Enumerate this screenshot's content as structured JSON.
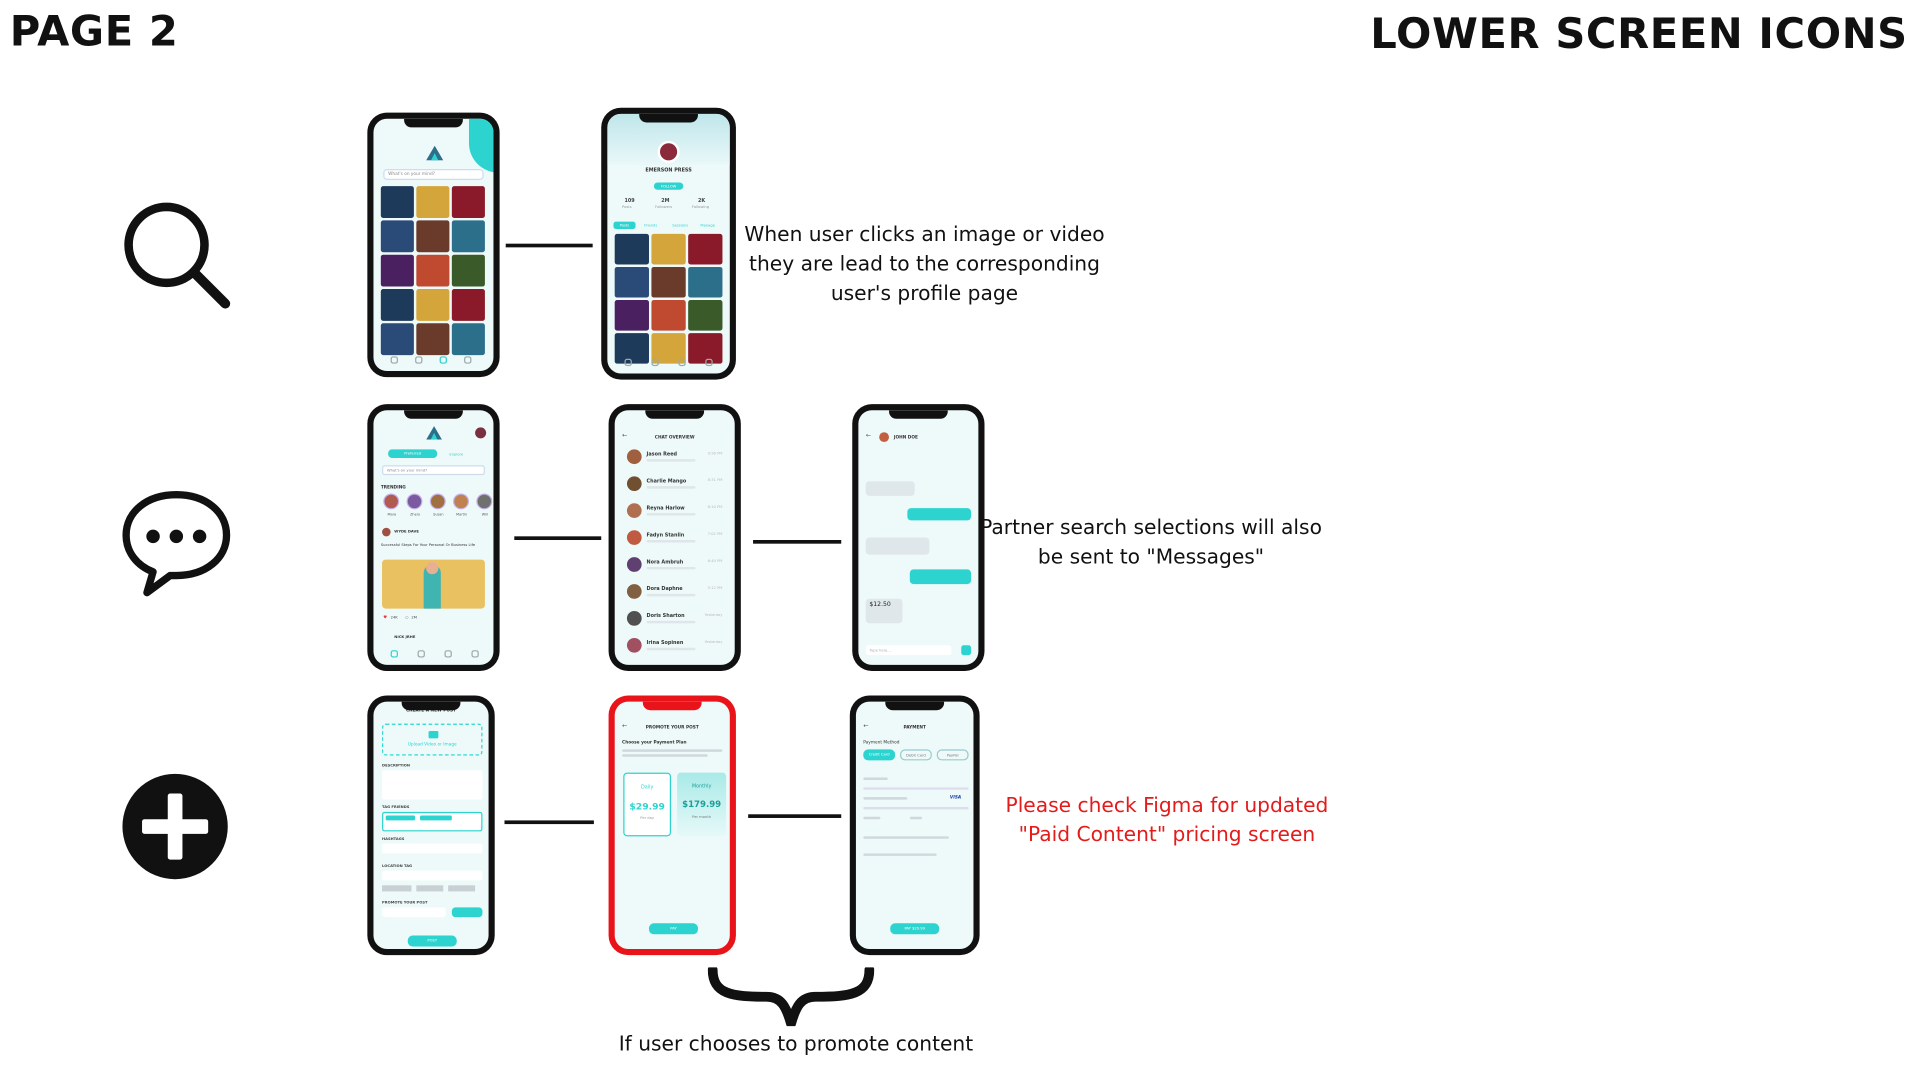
{
  "headings": {
    "page": "PAGE 2",
    "section": "LOWER SCREEN ICONS"
  },
  "notes": {
    "search": "When user clicks an image or video they are lead to the corresponding user's profile page",
    "messages": "Partner search selections will also be sent to \"Messages\"",
    "figma": "Please check Figma for updated \"Paid Content\" pricing screen",
    "promote": "If user chooses to promote content"
  },
  "colors": {
    "accent": "#2dd4cf",
    "warning": "#e31b1b",
    "frame_highlight": "#e8141a"
  },
  "icons": [
    "search-icon",
    "chat-bubble-icon",
    "plus-circle-icon",
    "curly-brace"
  ],
  "screens": {
    "search": {
      "placeholder": "What's on your mind?"
    },
    "profile": {
      "name": "EMERSON PRESS",
      "follow": "FOLLOW",
      "stats": [
        {
          "value": "109",
          "label": "Posts"
        },
        {
          "value": "2M",
          "label": "Followers"
        },
        {
          "value": "2K",
          "label": "Following"
        }
      ],
      "tabs": [
        "Posts",
        "Friends",
        "Sessions",
        "Manage"
      ]
    },
    "feed": {
      "tabs": [
        "Preferred",
        "Explore"
      ],
      "placeholder": "What's on your mind?",
      "trending": "TRENDING",
      "people": [
        "Mara",
        "Zhery",
        "Susan",
        "Martin",
        "Will"
      ],
      "post_user": "WYDE DAVE",
      "post_title": "Successful Steps For Your Personal Or Business Life",
      "likes": "24K",
      "comments": "2M",
      "next_user": "NICK JRHE"
    },
    "chat_overview": {
      "title": "CHAT OVERVIEW",
      "chats": [
        {
          "name": "Jason Reed",
          "time": "9:56 PM"
        },
        {
          "name": "Charlie Mango",
          "time": "8:31 PM"
        },
        {
          "name": "Reyna Harlow",
          "time": "8:10 PM"
        },
        {
          "name": "Fadyn Stanlin",
          "time": "7:02 PM"
        },
        {
          "name": "Nora Ambruh",
          "time": "6:40 PM"
        },
        {
          "name": "Dora Daphne",
          "time": "5:12 PM"
        },
        {
          "name": "Doris Sharton",
          "time": "Yesterday"
        },
        {
          "name": "Irina Sopinen",
          "time": "Yesterday"
        }
      ]
    },
    "conversation": {
      "name": "JOHN DOE",
      "amount": "$12.50",
      "placeholder": "Type here..."
    },
    "create_post": {
      "title": "CREATE A NEW POST",
      "upload": "Upload Video or Image",
      "description": "DESCRIPTION",
      "tag_friends": "TAG FRIENDS",
      "hashtags": "HASHTAGS",
      "location": "LOCATION TAG",
      "promote": "PROMOTE YOUR POST",
      "post": "POST"
    },
    "promote_post": {
      "title": "PROMOTE YOUR POST",
      "subtitle": "Choose your Payment Plan",
      "plans": [
        {
          "name": "Daily",
          "price": "$29.99",
          "period": "Per day"
        },
        {
          "name": "Monthly",
          "price": "$179.99",
          "period": "Per month"
        }
      ],
      "button": "PAY"
    },
    "payment": {
      "title": "PAYMENT",
      "method_label": "Payment Method",
      "methods": [
        "Credit Card",
        "Debit Card",
        "PayPal"
      ],
      "card_brand": "VISA",
      "button": "PAY $29.99"
    }
  }
}
